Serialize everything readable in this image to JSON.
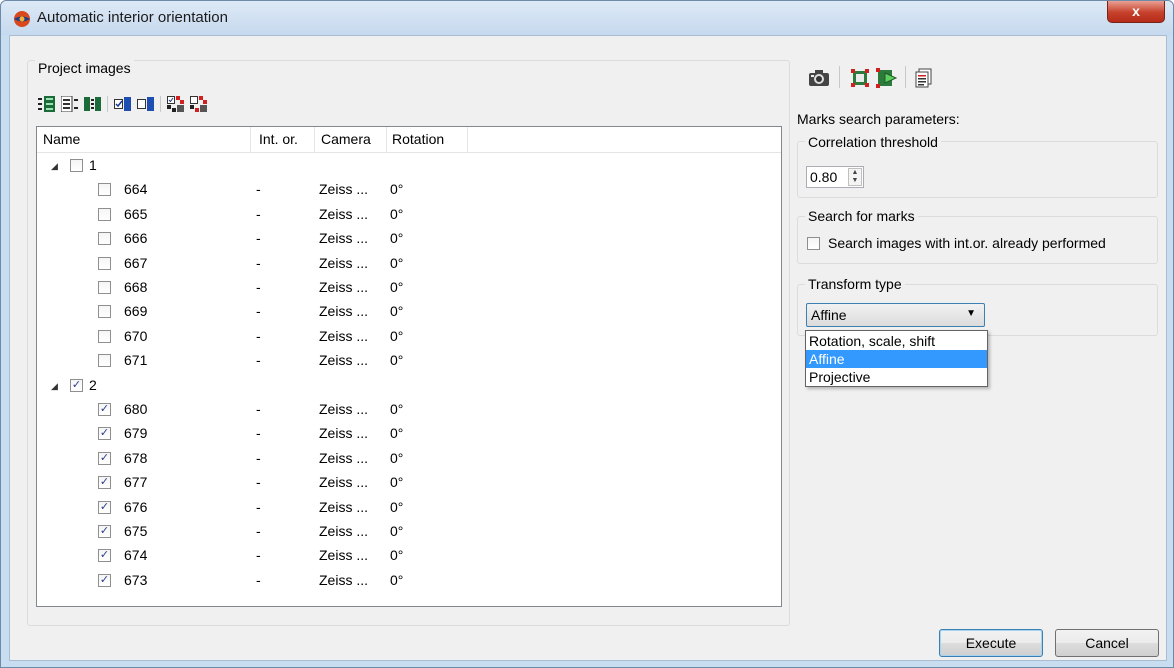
{
  "window": {
    "title": "Automatic interior orientation",
    "close_glyph": "x"
  },
  "project": {
    "group_label": "Project images",
    "toolbar_icons": [
      "expand-all-icon",
      "collapse-list-icon",
      "tree-view-icon",
      "check-all-icon",
      "uncheck-all-icon",
      "select-marks-icon",
      "clear-marks-icon"
    ],
    "columns": [
      "Name",
      "Int. or.",
      "Camera",
      "Rotation"
    ],
    "groups": [
      {
        "name": "1",
        "checked": false,
        "items": [
          {
            "name": "664",
            "intor": "-",
            "camera": "Zeiss ...",
            "rotation": "0°",
            "checked": false
          },
          {
            "name": "665",
            "intor": "-",
            "camera": "Zeiss ...",
            "rotation": "0°",
            "checked": false
          },
          {
            "name": "666",
            "intor": "-",
            "camera": "Zeiss ...",
            "rotation": "0°",
            "checked": false
          },
          {
            "name": "667",
            "intor": "-",
            "camera": "Zeiss ...",
            "rotation": "0°",
            "checked": false
          },
          {
            "name": "668",
            "intor": "-",
            "camera": "Zeiss ...",
            "rotation": "0°",
            "checked": false
          },
          {
            "name": "669",
            "intor": "-",
            "camera": "Zeiss ...",
            "rotation": "0°",
            "checked": false
          },
          {
            "name": "670",
            "intor": "-",
            "camera": "Zeiss ...",
            "rotation": "0°",
            "checked": false
          },
          {
            "name": "671",
            "intor": "-",
            "camera": "Zeiss ...",
            "rotation": "0°",
            "checked": false
          }
        ]
      },
      {
        "name": "2",
        "checked": true,
        "items": [
          {
            "name": "680",
            "intor": "-",
            "camera": "Zeiss ...",
            "rotation": "0°",
            "checked": true
          },
          {
            "name": "679",
            "intor": "-",
            "camera": "Zeiss ...",
            "rotation": "0°",
            "checked": true
          },
          {
            "name": "678",
            "intor": "-",
            "camera": "Zeiss ...",
            "rotation": "0°",
            "checked": true
          },
          {
            "name": "677",
            "intor": "-",
            "camera": "Zeiss ...",
            "rotation": "0°",
            "checked": true
          },
          {
            "name": "676",
            "intor": "-",
            "camera": "Zeiss ...",
            "rotation": "0°",
            "checked": true
          },
          {
            "name": "675",
            "intor": "-",
            "camera": "Zeiss ...",
            "rotation": "0°",
            "checked": true
          },
          {
            "name": "674",
            "intor": "-",
            "camera": "Zeiss ...",
            "rotation": "0°",
            "checked": true
          },
          {
            "name": "673",
            "intor": "-",
            "camera": "Zeiss ...",
            "rotation": "0°",
            "checked": true
          }
        ]
      }
    ]
  },
  "right_toolbar_icons": [
    "camera-icon",
    "marks-frame-icon",
    "marks-run-icon",
    "report-icon"
  ],
  "params": {
    "heading": "Marks search parameters:",
    "correlation": {
      "label": "Correlation threshold",
      "value": "0.80"
    },
    "search": {
      "label": "Search for marks",
      "checkbox_label": "Search images with int.or. already performed",
      "checked": false
    },
    "transform": {
      "label": "Transform type",
      "selected": "Affine",
      "options": [
        "Rotation, scale, shift",
        "Affine",
        "Projective"
      ]
    }
  },
  "buttons": {
    "execute": "Execute",
    "cancel": "Cancel"
  },
  "colors": {
    "selection": "#3399ff",
    "titlebar": "#c6d9ee",
    "close": "#c6402b"
  }
}
